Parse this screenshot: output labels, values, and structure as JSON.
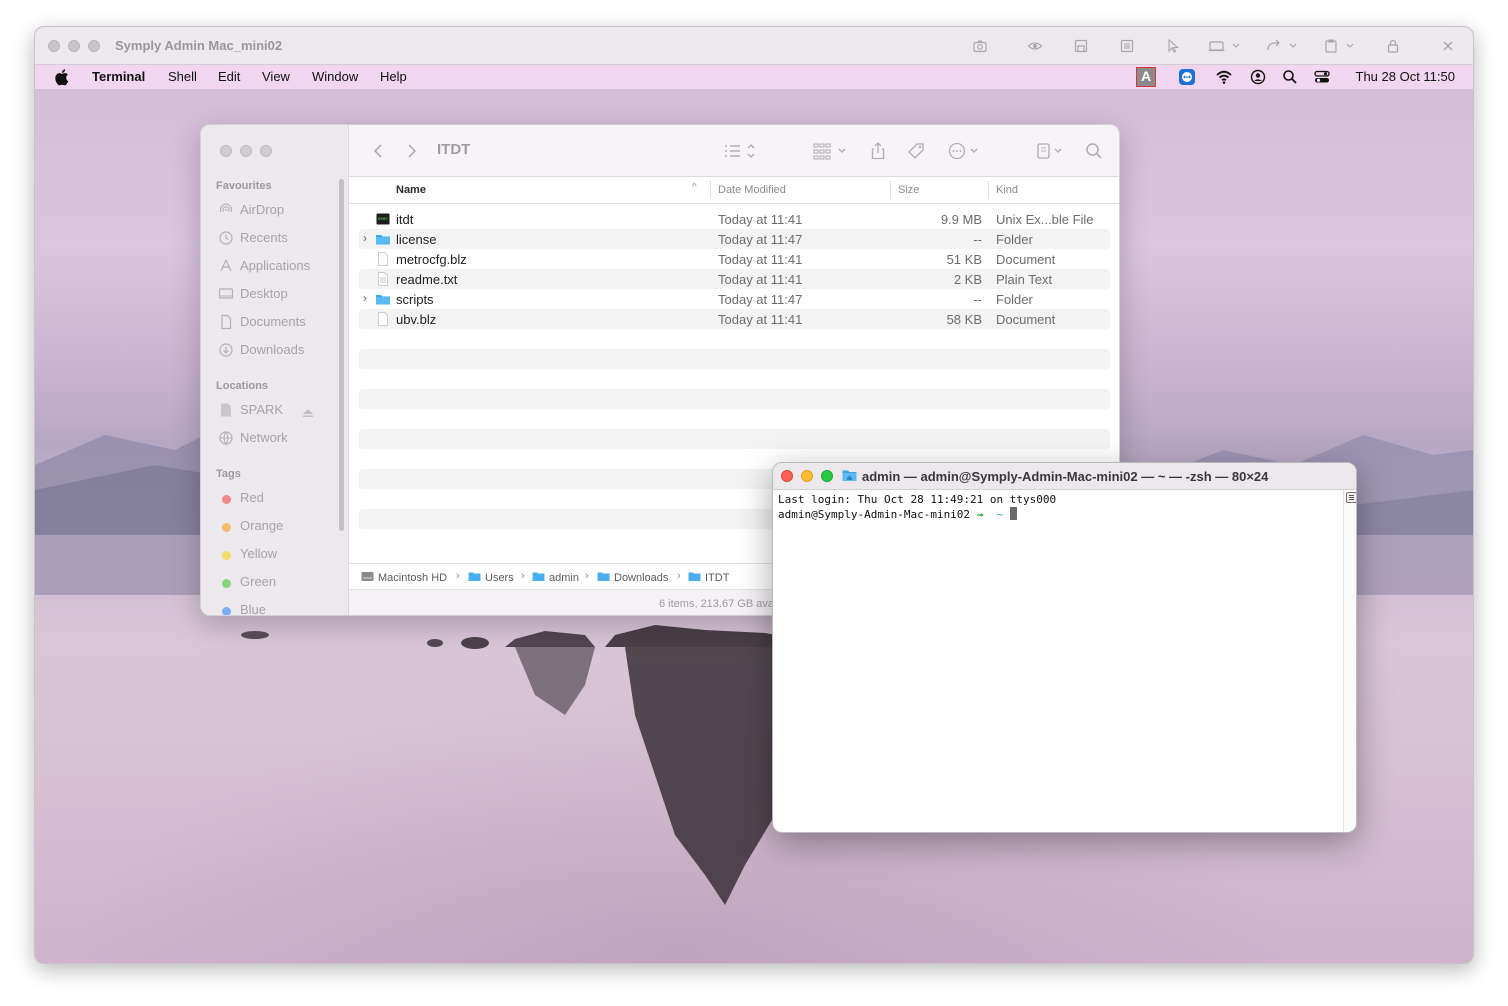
{
  "outer_window": {
    "title": "Symply Admin Mac_mini02",
    "toolbar_icons": [
      "camera-icon",
      "eye-icon",
      "remote-view-icon",
      "grid-icon",
      "pointer-icon",
      "display-icon",
      "redo-icon",
      "clipboard-icon",
      "lock-icon",
      "close-icon"
    ]
  },
  "menubar": {
    "apple": "",
    "app_name": "Terminal",
    "items": [
      "Shell",
      "Edit",
      "View",
      "Window",
      "Help"
    ],
    "input_source": "A",
    "clock": "Thu 28 Oct  11:50"
  },
  "finder": {
    "title": "ITDT",
    "sidebar": {
      "favourites_heading": "Favourites",
      "favourites": [
        {
          "label": "AirDrop",
          "icon": "airdrop-icon"
        },
        {
          "label": "Recents",
          "icon": "clock-icon"
        },
        {
          "label": "Applications",
          "icon": "applications-icon"
        },
        {
          "label": "Desktop",
          "icon": "desktop-icon"
        },
        {
          "label": "Documents",
          "icon": "document-icon"
        },
        {
          "label": "Downloads",
          "icon": "download-icon"
        }
      ],
      "locations_heading": "Locations",
      "locations": [
        {
          "label": "SPARK",
          "icon": "disk-icon"
        },
        {
          "label": "Network",
          "icon": "network-icon"
        }
      ],
      "tags_heading": "Tags",
      "tags": [
        {
          "label": "Red",
          "color": "#f08b86"
        },
        {
          "label": "Orange",
          "color": "#f5bd6a"
        },
        {
          "label": "Yellow",
          "color": "#f3dc6b"
        },
        {
          "label": "Green",
          "color": "#86d57e"
        },
        {
          "label": "Blue",
          "color": "#7aaef5"
        }
      ]
    },
    "columns": {
      "name": "Name",
      "date": "Date Modified",
      "size": "Size",
      "kind": "Kind"
    },
    "files": [
      {
        "name": "itdt",
        "date": "Today at 11:41",
        "size": "9.9 MB",
        "kind": "Unix Ex...ble File",
        "type": "exec"
      },
      {
        "name": "license",
        "date": "Today at 11:47",
        "size": "--",
        "kind": "Folder",
        "type": "folder"
      },
      {
        "name": "metrocfg.blz",
        "date": "Today at 11:41",
        "size": "51 KB",
        "kind": "Document",
        "type": "doc"
      },
      {
        "name": "readme.txt",
        "date": "Today at 11:41",
        "size": "2 KB",
        "kind": "Plain Text",
        "type": "text"
      },
      {
        "name": "scripts",
        "date": "Today at 11:47",
        "size": "--",
        "kind": "Folder",
        "type": "folder"
      },
      {
        "name": "ubv.blz",
        "date": "Today at 11:41",
        "size": "58 KB",
        "kind": "Document",
        "type": "doc"
      }
    ],
    "path": [
      "Macintosh HD",
      "Users",
      "admin",
      "Downloads",
      "ITDT"
    ],
    "status": "6 items, 213.67 GB available"
  },
  "terminal": {
    "title": "admin — admin@Symply-Admin-Mac-mini02 — ~ — -zsh — 80×24",
    "lines": {
      "last_login": "Last login: Thu Oct 28 11:49:21 on ttys000",
      "prompt_user": "admin@Symply-Admin-Mac-mini02",
      "prompt_arrow": "→",
      "prompt_dir": "~"
    }
  }
}
